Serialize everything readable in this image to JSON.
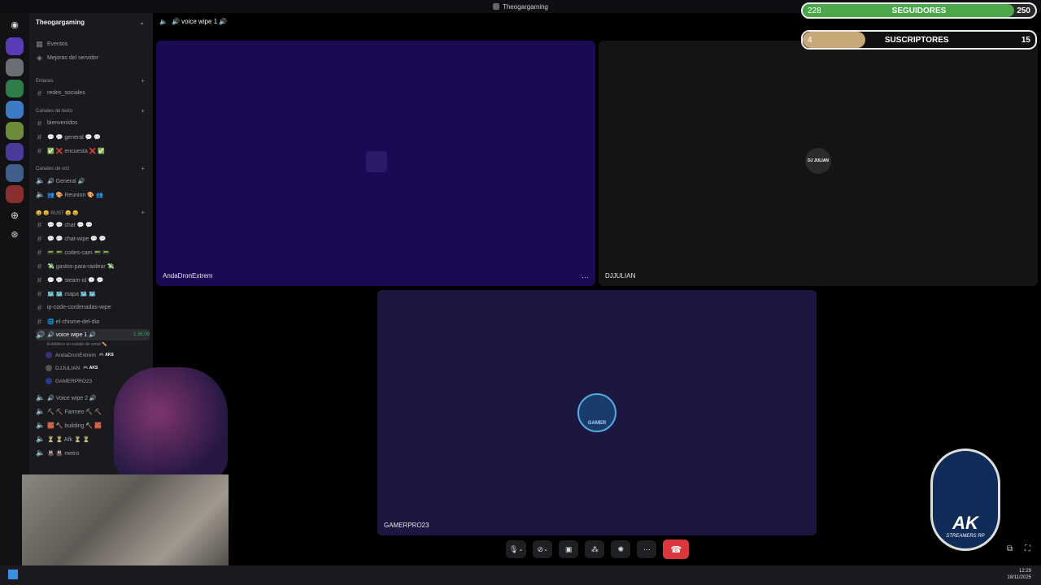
{
  "window": {
    "title": "Theogargaming"
  },
  "sidebar": {
    "server_name": "Theogargaming",
    "top_items": [
      {
        "label": "Eventos"
      },
      {
        "label": "Mejoras del servidor"
      }
    ],
    "categories": {
      "links": "Enlaces",
      "text": "Canales de texto",
      "voice": "Canales de voz",
      "rust": "😀 😀 RUST 😀 😀"
    },
    "channels": {
      "redes_sociales": "redes_sociales",
      "bienvenidos": "bienvenidos",
      "general": "💬 💬 general 💬 💬",
      "encuesta": "✅ ❌ encuesta ❌ ✅",
      "voice_general": "🔊 General 🔊",
      "reunion": "👥 🎨 Reunion 🎨 👥",
      "chat": "💬 💬 chat 💬 💬",
      "chat_wipe": "💬 💬 chat-wipe 💬 💬",
      "codes_cam": "📟 📟 codes-cam 📟 📟",
      "gastos": "💸 gastos-para-raidear 💸",
      "steam_id": "💬 💬 steam-id 💬 💬",
      "mapa": "🗺️ 🗺️ mapa 🗺️ 🗺️",
      "ip_code": "ip-code-cordenadas-wipe",
      "chisme": "🌐 el-chisme-del-dia",
      "voice_wipe1": "🔊 voice wipe 1 🔊",
      "voice_wipe1_timer": "1:36:09",
      "voice_wipe1_status": "Establece un estado de canal ✏️",
      "voice_wipe2": "🔊 Voice wipe 2 🔊",
      "farmeo": "⛏️ ⛏️ Farmeo ⛏️ ⛏️",
      "building": "🧱 🔨 building 🔨 🧱",
      "afk": "⏳ ⏳ Afk ⏳ ⏳",
      "metro": "🚇 🚇 metro"
    },
    "voice_users": [
      {
        "name": "AndaDronExtrem",
        "badge": "🎮 AKS"
      },
      {
        "name": "DJJULIAN",
        "badge": "🎮 AKS"
      },
      {
        "name": "GAMERPRO23",
        "badge": ""
      }
    ]
  },
  "main": {
    "header": "🔊 voice wipe 1 🔊",
    "tiles": [
      {
        "name": "AndaDronExtrem"
      },
      {
        "name": "DJJULIAN",
        "avatar_text": "DJ JULIAN"
      },
      {
        "name": "GAMERPRO23",
        "avatar_text": "GAMER"
      }
    ],
    "more_label": "···"
  },
  "overlay": {
    "followers": {
      "current": "228",
      "label": "SEGUIDORES",
      "goal": "250",
      "progress": 0.91
    },
    "subscribers": {
      "current": "4",
      "label": "SUSCRIPTORES",
      "goal": "15",
      "progress": 0.27
    },
    "logo_text": "AK",
    "logo_sub": "STREAMERS RP"
  },
  "taskbar": {
    "time": "12:29",
    "date": "18/11/2025"
  },
  "colors": {
    "accent_green": "#3ba55c",
    "end_call": "#da373c",
    "tile_purple": "#1a0a55",
    "tile_dark": "#141414",
    "tile_navy": "#1b1740"
  }
}
